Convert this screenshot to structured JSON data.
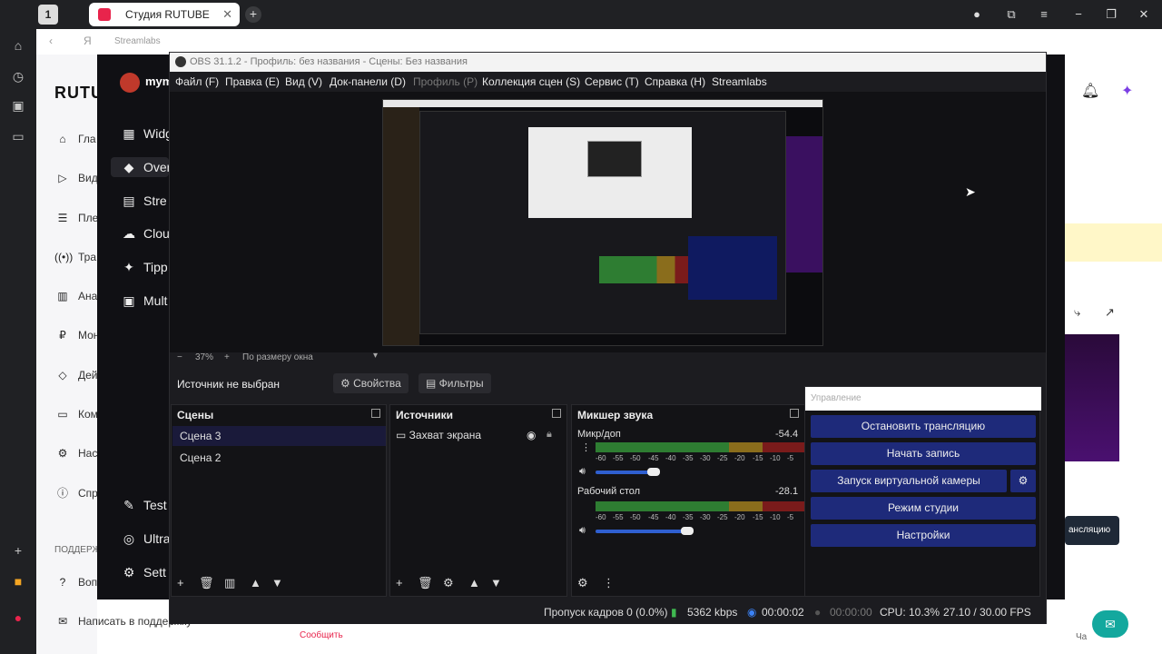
{
  "browser": {
    "tab_number": "1",
    "tab_title": "Студия RUTUBE",
    "tab_close": "✕",
    "new_tab": "+",
    "address_title": "Streamlabs"
  },
  "rutube": {
    "logo": "RUTU",
    "sidebar": [
      {
        "icon": "⌂",
        "label": "Гла"
      },
      {
        "icon": "▷",
        "label": "Вид"
      },
      {
        "icon": "☰",
        "label": "Пле"
      },
      {
        "icon": "((•))",
        "label": "Тра"
      },
      {
        "icon": "▥",
        "label": "Ана"
      },
      {
        "icon": "₽",
        "label": "Мон"
      },
      {
        "icon": "◇",
        "label": "Дей"
      },
      {
        "icon": "▭",
        "label": "Ком"
      },
      {
        "icon": "⚙",
        "label": "Нас"
      },
      {
        "icon": "ⓘ",
        "label": "Спр"
      }
    ],
    "support_header": "ПОДДЕРЖ",
    "support_items": [
      {
        "icon": "?",
        "label": "Воп"
      },
      {
        "icon": "✉",
        "label": "Написать в поддержку"
      }
    ],
    "footer_link": "Сообщить",
    "right_button": "ансляцию",
    "right_small": "Ча"
  },
  "streamlabs": {
    "user": "mym",
    "items": [
      {
        "icon": "▦",
        "label": "Widg"
      },
      {
        "icon": "◆",
        "label": "Over"
      },
      {
        "icon": "▤",
        "label": "Stre"
      },
      {
        "icon": "☁",
        "label": "Clou"
      },
      {
        "icon": "✦",
        "label": "Tipp"
      },
      {
        "icon": "▣",
        "label": "Mult"
      },
      {
        "icon": "✎",
        "label": "Test"
      },
      {
        "icon": "◎",
        "label": "Ultra"
      },
      {
        "icon": "⚙",
        "label": "Sett"
      }
    ]
  },
  "obs": {
    "title": "OBS 31.1.2 - Профиль: без названия - Сцены: Без названия",
    "menu": [
      "Файл (F)",
      "Правка (E)",
      "Вид (V)",
      "Док-панели (D)",
      "Профиль (P)",
      "Коллекция сцен (S)",
      "Сервис (T)",
      "Справка (H)",
      "Streamlabs"
    ],
    "zoom": {
      "minus": "−",
      "value": "37%",
      "plus": "+",
      "fit": "По размеру окна"
    },
    "no_source": "Источник не выбран",
    "properties_btn": "Свойства",
    "filters_btn": "Фильтры",
    "scenes": {
      "title": "Сцены",
      "items": [
        "Сцена 3",
        "Сцена 2"
      ]
    },
    "sources": {
      "title": "Источники",
      "items": [
        "Захват экрана"
      ]
    },
    "mixer": {
      "title": "Микшер звука",
      "ticks": [
        "-60",
        "-55",
        "-50",
        "-45",
        "-40",
        "-35",
        "-30",
        "-25",
        "-20",
        "-15",
        "-10",
        "-5"
      ],
      "channels": [
        {
          "name": "Микр/доп",
          "db": "-54.4",
          "volume": 0.62
        },
        {
          "name": "Рабочий стол",
          "db": "-28.1",
          "volume": 0.97
        }
      ]
    },
    "controls": {
      "header": "Управление",
      "buttons": [
        "Остановить трансляцию",
        "Начать запись",
        "Запуск виртуальной камеры",
        "Режим студии",
        "Настройки"
      ]
    },
    "status": {
      "dropped": "Пропуск кадров 0 (0.0%)",
      "bitrate": "5362 kbps",
      "stream_time": "00:00:02",
      "rec_time": "00:00:00",
      "cpu": "CPU: 10.3%",
      "fps": "27.10 / 30.00 FPS"
    }
  },
  "colors": {
    "accent_blue": "#1e2a7a",
    "meter_green": "#2e7d32",
    "rutube_red": "#e8244c"
  }
}
